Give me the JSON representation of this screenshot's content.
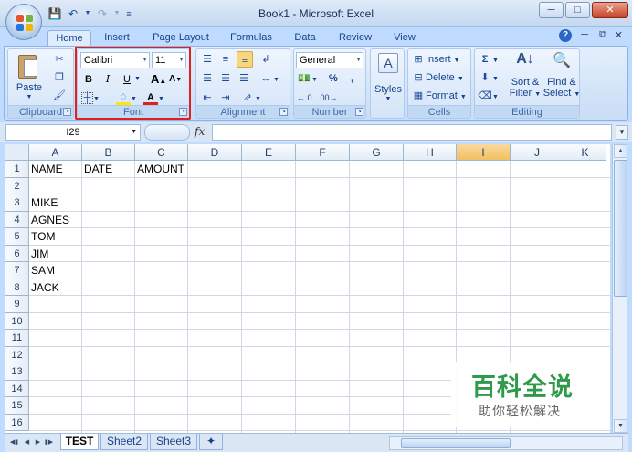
{
  "window": {
    "title": "Book1 - Microsoft Excel"
  },
  "tabs": [
    "Home",
    "Insert",
    "Page Layout",
    "Formulas",
    "Data",
    "Review",
    "View"
  ],
  "ribbon": {
    "clipboard": {
      "label": "Clipboard",
      "paste": "Paste"
    },
    "font": {
      "label": "Font",
      "name": "Calibri",
      "size": "11",
      "bold": "B",
      "italic": "I",
      "underline": "U"
    },
    "alignment": {
      "label": "Alignment"
    },
    "number": {
      "label": "Number",
      "format": "General",
      "percent": "%",
      "comma": ","
    },
    "styles": {
      "label": "Styles"
    },
    "cells": {
      "label": "Cells",
      "insert": "Insert",
      "delete": "Delete",
      "format": "Format"
    },
    "editing": {
      "label": "Editing",
      "sort": "Sort &",
      "sort2": "Filter",
      "find": "Find &",
      "find2": "Select"
    }
  },
  "formula_bar": {
    "name_box": "I29",
    "fx": "fx"
  },
  "columns": [
    "A",
    "B",
    "C",
    "D",
    "E",
    "F",
    "G",
    "H",
    "I",
    "J",
    "K"
  ],
  "rows": [
    "1",
    "2",
    "3",
    "4",
    "5",
    "6",
    "7",
    "8",
    "9",
    "10",
    "11",
    "12",
    "13",
    "14",
    "15",
    "16"
  ],
  "cells": {
    "A1": "NAME",
    "B1": "DATE",
    "C1": "AMOUNT",
    "A3": "MIKE",
    "A4": "AGNES",
    "A5": "TOM",
    "A6": "JIM",
    "A7": "SAM",
    "A8": "JACK"
  },
  "sheets": [
    "TEST",
    "Sheet2",
    "Sheet3"
  ],
  "watermark": {
    "title": "百科全说",
    "subtitle": "助你轻松解决"
  }
}
